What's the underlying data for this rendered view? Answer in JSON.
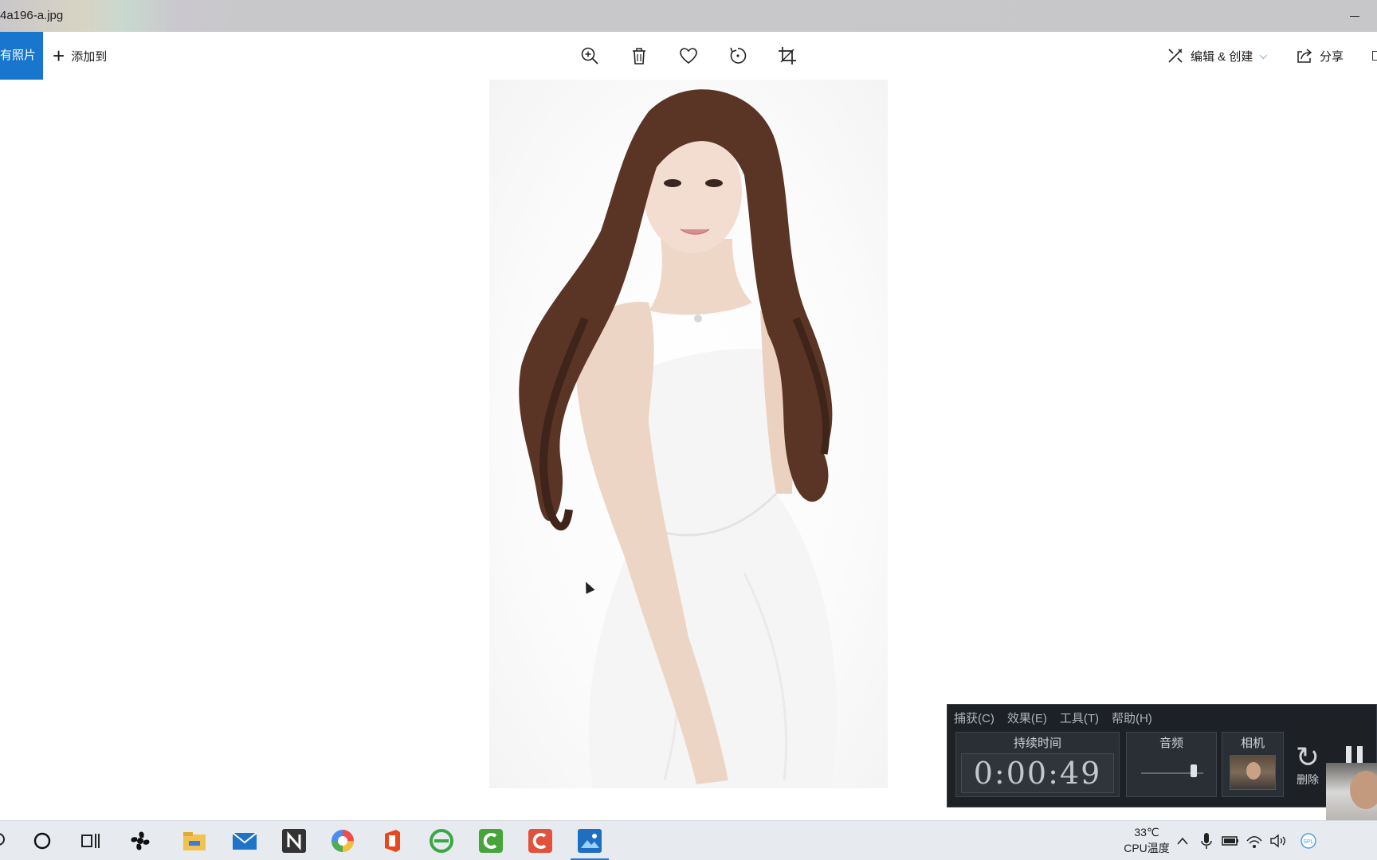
{
  "window": {
    "title": "4a196-a.jpg"
  },
  "toolbar": {
    "all_photos_label": "有照片",
    "add_to_label": "添加到",
    "icons": [
      "zoom-in-icon",
      "trash-icon",
      "heart-icon",
      "rotate-icon",
      "crop-icon"
    ],
    "edit_create_label": "编辑 & 创建",
    "share_label": "分享"
  },
  "capture": {
    "menu": [
      "捕获(C)",
      "效果(E)",
      "工具(T)",
      "帮助(H)"
    ],
    "duration_label": "持续时间",
    "duration_value": "0:00:49",
    "audio_label": "音频",
    "audio_level": 0.85,
    "camera_label": "相机",
    "delete_label": "删除"
  },
  "taskbar": {
    "apps": [
      "search-icon",
      "cortana-icon",
      "task-view-icon",
      "fan-app-icon",
      "file-explorer-icon",
      "mail-icon",
      "n-app-icon",
      "color-app-icon",
      "office-icon",
      "browser-icon",
      "camtasia-green-icon",
      "camtasia-red-icon",
      "photos-icon"
    ],
    "cpu_temp": "33℃",
    "cpu_label": "CPU温度"
  },
  "colors": {
    "accent": "#1976cf",
    "capture_bg": "#1d2126",
    "taskbar_bg": "#e7ebf0"
  }
}
